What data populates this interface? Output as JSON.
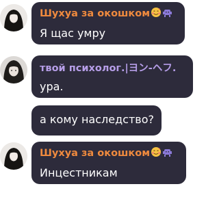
{
  "messages": [
    {
      "author": "Шухуа за окошком",
      "author_color": "#ef8a3e",
      "text": "Я щас умру",
      "emojis": [
        "smiling-face-with-hearts-icon",
        "alien-monster-icon"
      ]
    },
    {
      "author": "твой психолог.|ヨン-ヘフ.",
      "author_color": "#b69ee8",
      "text": "ура."
    },
    {
      "text": "а кому наследство?"
    },
    {
      "author": "Шухуа за окошком",
      "author_color": "#ef8a3e",
      "text": "Инцестникам",
      "emojis": [
        "smiling-face-with-hearts-icon",
        "alien-monster-icon"
      ]
    }
  ]
}
